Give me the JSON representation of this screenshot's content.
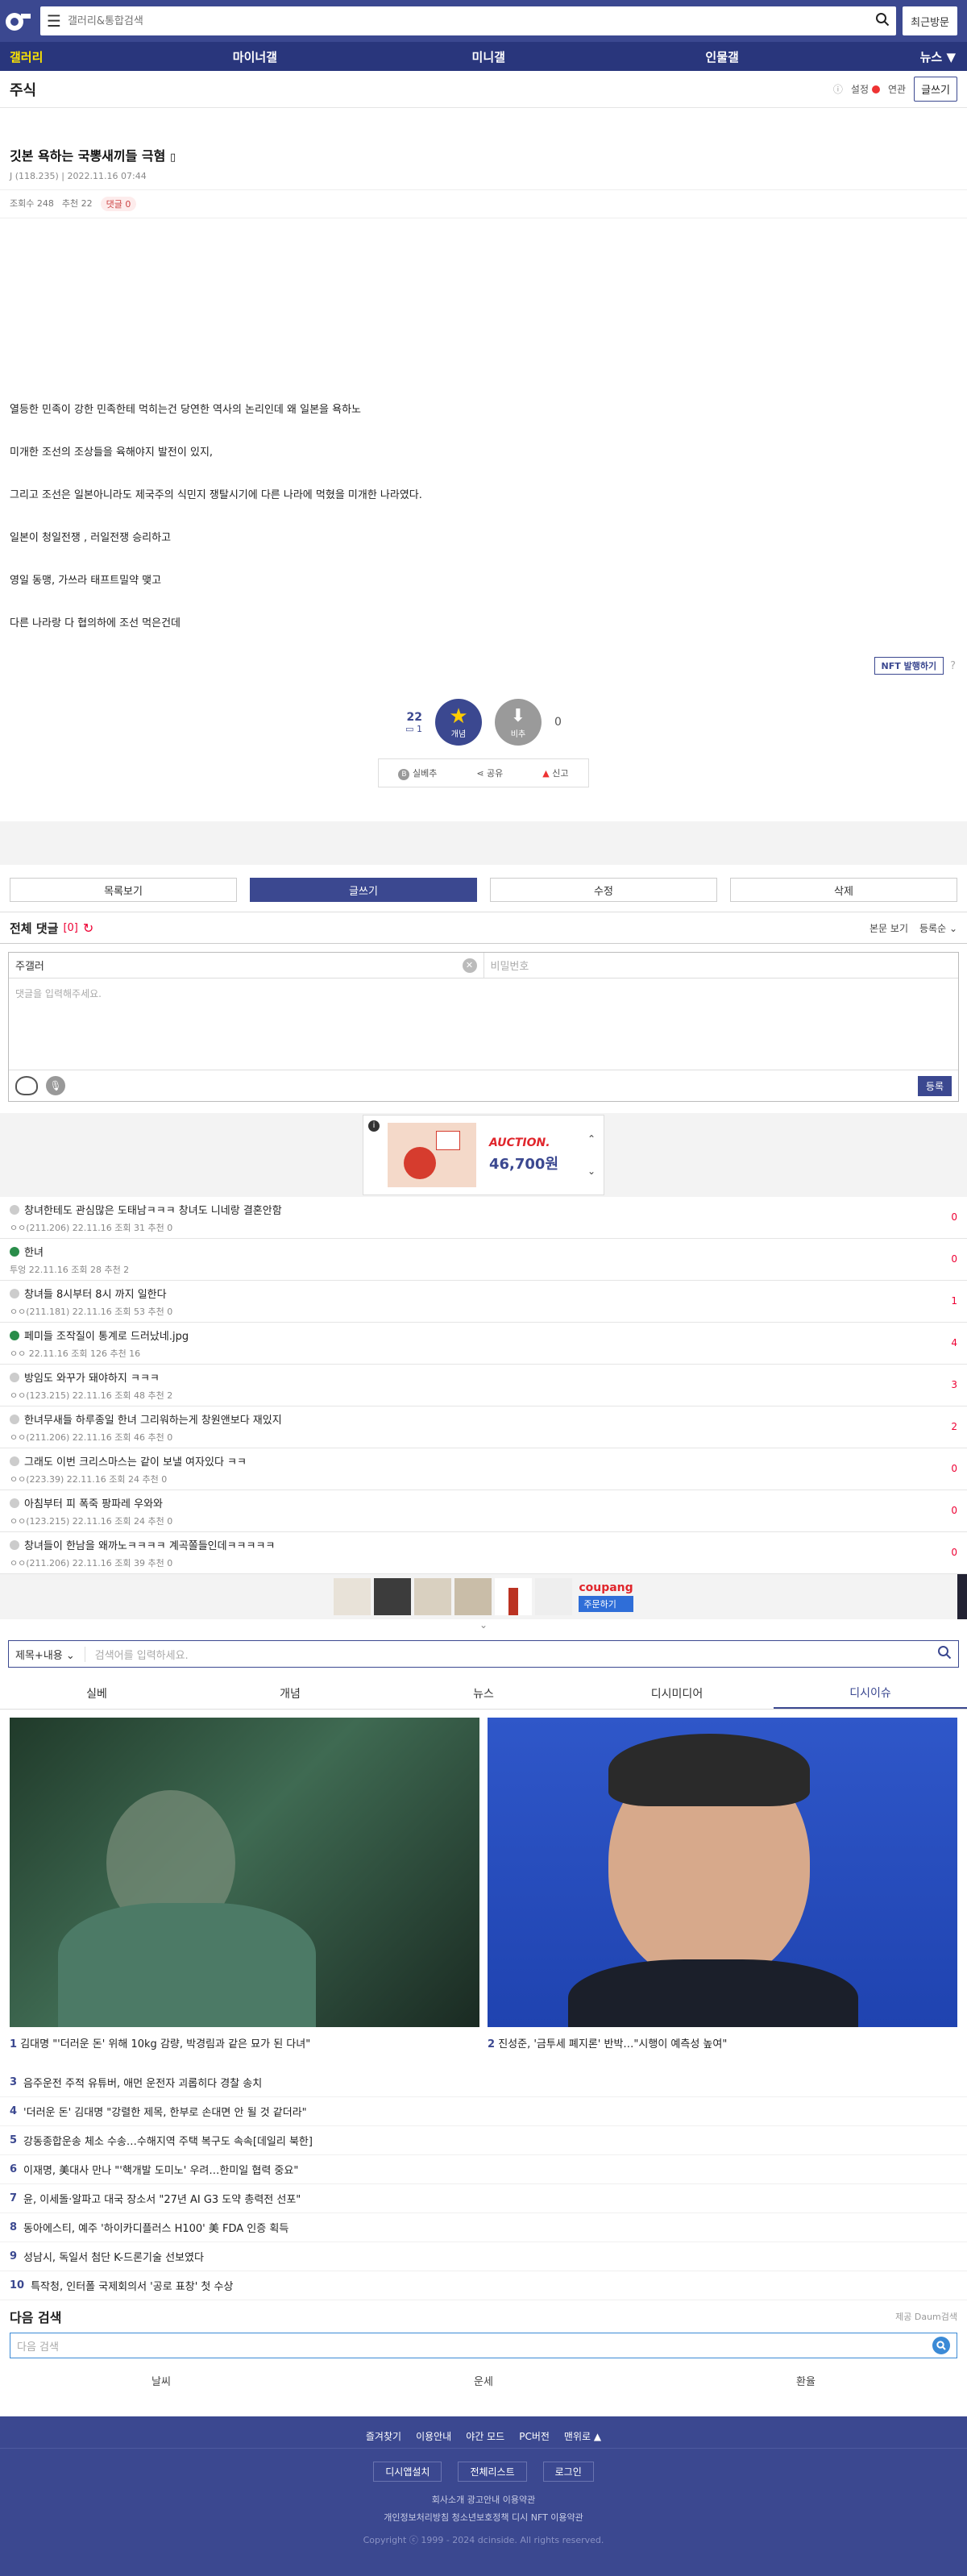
{
  "header": {
    "search_placeholder": "갤러리&통합검색",
    "recent": "최근방문"
  },
  "gnb": [
    "갤러리",
    "마이너갤",
    "미니갤",
    "인물갤",
    "뉴스"
  ],
  "gallery": {
    "title": "주식",
    "settings": "설정",
    "related": "연관",
    "write": "글쓰기"
  },
  "post": {
    "title": "깃본 욕하는 국뽕새끼들 극혐",
    "author": "J (118.235)",
    "date": "2022.11.16 07:44",
    "views": "조회수 248",
    "recommend": "추천 22",
    "comments": "댓글 0",
    "paragraphs": [
      "열등한 민족이 강한 민족한테 먹히는건 당연한 역사의 논리인데 왜 일본을 욕하노",
      "미개한 조선의 조상들을 육해야지 발전이 있지,",
      "그리고 조선은 일본아니라도 제국주의 식민지 쟁탈시기에 다른 나라에 먹혔을 미개한 나라였다.",
      "일본이 청일전쟁 , 러일전쟁 승리하고",
      "영일 동맹, 가쓰라 태프트밀약 맺고",
      "다른 나라랑 다 협의하에 조선 먹은건데"
    ],
    "nft": "NFT 발행하기",
    "vote_up": "22",
    "vote_fix": "1",
    "vote_down": "0",
    "up_label": "개념",
    "down_label": "비추",
    "actions": [
      "실베추",
      "공유",
      "신고"
    ]
  },
  "buttons": [
    "목록보기",
    "글쓰기",
    "수정",
    "삭제"
  ],
  "comments_header": {
    "title": "전체 댓글",
    "count": "[0]",
    "view": "본문 보기",
    "sort": "등록순"
  },
  "form": {
    "name": "주갤러",
    "password": "비밀번호",
    "placeholder": "댓글을 입력해주세요.",
    "submit": "등록"
  },
  "ad": {
    "brand": "AUCTION.",
    "price": "46,700원"
  },
  "list": [
    {
      "title": "창녀한테도 관심많은 도태남ㅋㅋㅋ 창녀도 니네랑 결혼안함",
      "meta": "ㅇㅇ(211.206)  22.11.16  조회 31  추천 0",
      "n": "0",
      "g": false
    },
    {
      "title": "한녀",
      "meta": "투엉  22.11.16  조회 28  추천 2",
      "n": "0",
      "g": true
    },
    {
      "title": "창녀들 8시부터 8시 까지 일한다",
      "meta": "ㅇㅇ(211.181)  22.11.16  조회 53  추천 0",
      "n": "1",
      "g": false
    },
    {
      "title": "페미들 조작질이 통계로 드러났네.jpg",
      "meta": "ㅇㅇ  22.11.16  조회 126  추천 16",
      "n": "4",
      "g": true
    },
    {
      "title": "방임도 와꾸가 돼야하지 ㅋㅋㅋ",
      "meta": "ㅇㅇ(123.215)  22.11.16  조회 48  추천 2",
      "n": "3",
      "g": false
    },
    {
      "title": "한녀무새들 하루종일 한녀 그리워하는게 창원앤보다 재있지",
      "meta": "ㅇㅇ(211.206)  22.11.16  조회 46  추천 0",
      "n": "2",
      "g": false
    },
    {
      "title": "그래도 이번 크리스마스는 같이 보낼 여자있다 ㅋㅋ",
      "meta": "ㅇㅇ(223.39)  22.11.16  조회 24  추천 0",
      "n": "0",
      "g": false
    },
    {
      "title": "아침부터 피 폭죽 팡파레 우와와",
      "meta": "ㅇㅇ(123.215)  22.11.16  조회 24  추천 0",
      "n": "0",
      "g": false
    },
    {
      "title": "창녀들이 한남을 왜까노ㅋㅋㅋㅋ 계곡쫄들인데ㅋㅋㅋㅋㅋ",
      "meta": "ㅇㅇ(211.206)  22.11.16  조회 39  추천 0",
      "n": "0",
      "g": false
    }
  ],
  "coupang": {
    "brand": "coupang",
    "cta": "주문하기"
  },
  "search": {
    "scope": "제목+내용",
    "placeholder": "검색어를 입력하세요."
  },
  "tabs": [
    "실베",
    "개념",
    "뉴스",
    "디시미디어",
    "디시이슈"
  ],
  "captions": [
    {
      "num": "1",
      "text": "김대명 \"'더러운 돈' 위해 10kg 감량, 박경림과 같은 묘가 된 다녀\""
    },
    {
      "num": "2",
      "text": "진성준, '금투세 폐지론' 반박…\"시행이 예측성 높여\""
    }
  ],
  "news": [
    {
      "num": "3",
      "text": "음주운전 주적 유튜버, 애먼 운전자 괴롭히다 경찰 송치"
    },
    {
      "num": "4",
      "text": "'더러운 돈' 김대명 \"강렬한 제목, 한부로 손대면 안 될 것 같더라\""
    },
    {
      "num": "5",
      "text": "강동종합운송 체소 수송…수해지역 주택 복구도 속속[데일리 북한]"
    },
    {
      "num": "6",
      "text": "이재명, 美대사 만나 \"'핵개발 도미노' 우려…한미일 협력 중요\""
    },
    {
      "num": "7",
      "text": "윤, 이세돌·알파고 대국 장소서 \"27년 AI G3 도약 총력전 선포\""
    },
    {
      "num": "8",
      "text": "동아에스티, 예주 '하이카디플러스 H100' 美 FDA 인증 획득"
    },
    {
      "num": "9",
      "text": "성남시, 독일서 첨단 K-드론기술 선보였다"
    },
    {
      "num": "10",
      "text": "특작청, 인터폴 국제회의서 '공로 표창' 첫 수상"
    }
  ],
  "daum": {
    "title": "다음 검색",
    "provider": "제공 Daum검색",
    "placeholder": "다음 검색",
    "links": [
      "날씨",
      "운세",
      "환율"
    ]
  },
  "footer": {
    "links": [
      "즐겨찾기",
      "이용안내",
      "야간 모드",
      "PC버전",
      "맨위로 ▲"
    ],
    "buttons": [
      "디시앱설치",
      "전체리스트",
      "로그인"
    ],
    "corp": "회사소개   광고안내   이용약관",
    "policy": "개인정보처리방침   청소년보호정책   디시 NFT 이용약관",
    "copy": "Copyright ⓒ 1999 - 2024 dcinside. All rights reserved."
  }
}
